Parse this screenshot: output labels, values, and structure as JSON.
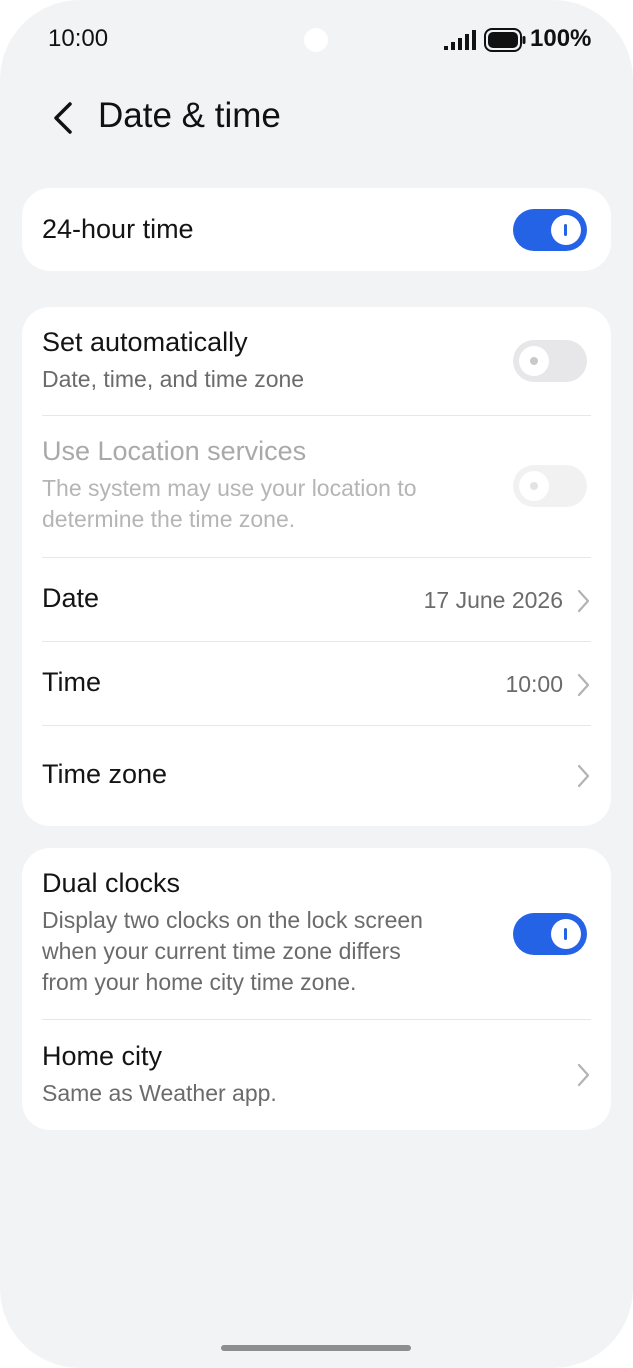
{
  "status_bar": {
    "time": "10:00",
    "battery": "100%"
  },
  "header": {
    "title": "Date & time"
  },
  "hour24": {
    "label": "24-hour time",
    "enabled": true
  },
  "auto": {
    "set_automatically": {
      "label": "Set automatically",
      "sub": "Date, time, and time zone",
      "enabled": false
    },
    "location": {
      "label": "Use Location services",
      "sub_line1": "The system may use your location to",
      "sub_line2": "determine the time zone.",
      "enabled": false,
      "disabled": true
    },
    "date": {
      "label": "Date",
      "value": "17 June 2026"
    },
    "time": {
      "label": "Time",
      "value": "10:00"
    },
    "timezone": {
      "label": "Time zone"
    }
  },
  "dual": {
    "dual_clocks": {
      "label": "Dual clocks",
      "sub_line1": "Display two clocks on the lock screen",
      "sub_line2": "when your current time zone differs",
      "sub_line3": "from your home city time zone.",
      "enabled": true
    },
    "home_city": {
      "label": "Home city",
      "sub": "Same as Weather app."
    }
  },
  "colors": {
    "accent": "#2563e6",
    "background": "#f2f3f5",
    "card": "#ffffff"
  }
}
